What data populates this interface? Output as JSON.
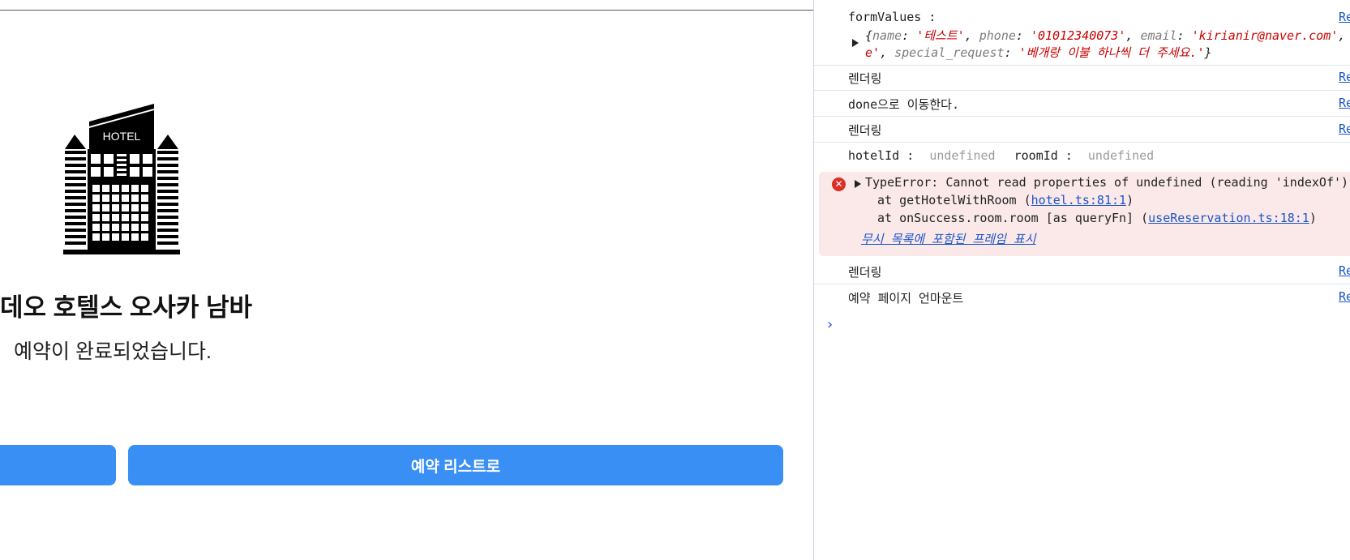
{
  "app": {
    "hotel_icon_text": "HOTEL",
    "hotel_name": "데오 호텔스 오사카 남바",
    "done_message": "예약이 완료되었습니다.",
    "buttons": {
      "left_label": "",
      "right_label": "예약 리스트로"
    },
    "accent_color": "#3a8ff5"
  },
  "console": {
    "source_link": "Re",
    "form_values": {
      "label": "formValues :",
      "line1": [
        {
          "t": "{",
          "c": "it"
        },
        {
          "t": "name",
          "c": "k"
        },
        {
          "t": ": ",
          "c": "it"
        },
        {
          "t": "'테스트'",
          "c": "s"
        },
        {
          "t": ", ",
          "c": "it"
        },
        {
          "t": "phone",
          "c": "k"
        },
        {
          "t": ": ",
          "c": "it"
        },
        {
          "t": "'01012340073'",
          "c": "s"
        },
        {
          "t": ", ",
          "c": "it"
        },
        {
          "t": "email",
          "c": "k"
        },
        {
          "t": ": ",
          "c": "it"
        },
        {
          "t": "'kirianir@naver.com'",
          "c": "s"
        },
        {
          "t": ",",
          "c": "it"
        }
      ],
      "line2": [
        {
          "t": "e'",
          "c": "s"
        },
        {
          "t": ", ",
          "c": "it"
        },
        {
          "t": "special_request",
          "c": "k"
        },
        {
          "t": ": ",
          "c": "it"
        },
        {
          "t": "'베개랑 이불 하나씩 더 주세요.'",
          "c": "s"
        },
        {
          "t": "}",
          "c": "it"
        }
      ]
    },
    "logs": {
      "rendering_1": "렌더링",
      "done_move": "done으로 이동한다.",
      "rendering_2": "렌더링",
      "rendering_3": "렌더링",
      "unmount": "예약 페이지 언마운트"
    },
    "ids": {
      "hotel_label": "hotelId :",
      "hotel_value": "undefined",
      "room_label": "roomId :",
      "room_value": "undefined"
    },
    "error": {
      "message": "TypeError: Cannot read properties of undefined (reading 'indexOf')",
      "stack1_prefix": "at getHotelWithRoom (",
      "stack1_link": "hotel.ts:81:1",
      "stack1_suffix": ")",
      "stack2_prefix": "at onSuccess.room.room [as queryFn] (",
      "stack2_link": "useReservation.ts:18:1",
      "stack2_suffix": ")",
      "ignored_frames": "무시 목록에 포함된 프레임 표시"
    },
    "prompt_symbol": "›"
  }
}
